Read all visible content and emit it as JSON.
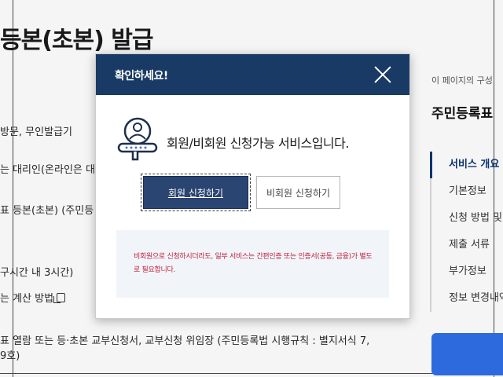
{
  "page": {
    "title": "등본(초본) 발급",
    "lines": [
      "방문, 무인발급기",
      "는 대리인(온라인은 대리",
      "표 등본(초본) (주민등",
      "구시간 내 3시간)",
      "는 계산 방법",
      "표 열람 또는 등·초본 교부신청서, 교부신청 위임장 (주민등록법 시행규칙 : 별지서식 7,",
      "9호)"
    ]
  },
  "aside": {
    "caption": "이 페이지의 구성",
    "heading": "주민등록표",
    "menu": [
      "서비스 개요",
      "기본정보",
      "신청 방법 및",
      "제출 서류",
      "부가정보",
      "정보 변경내역"
    ]
  },
  "modal": {
    "title": "확인하세요!",
    "message": "회원/비회원 신청가능 서비스입니다.",
    "member_button": "회원 신청하기",
    "nonmember_button": "비회원 신청하기",
    "notice": "비회원으로 신청하시더라도, 일부 서비스는 간편인증 또는 인증서(공동, 금융)가 별도로 필요합니다."
  },
  "colors": {
    "header": "#193a64",
    "primary_button": "#2a4571",
    "notice_text": "#c4203a",
    "notice_bg": "#f1f5f9",
    "aside_button": "#2f6fe6"
  },
  "icons": [
    "close-icon",
    "user-info-icon",
    "copy-icon"
  ]
}
